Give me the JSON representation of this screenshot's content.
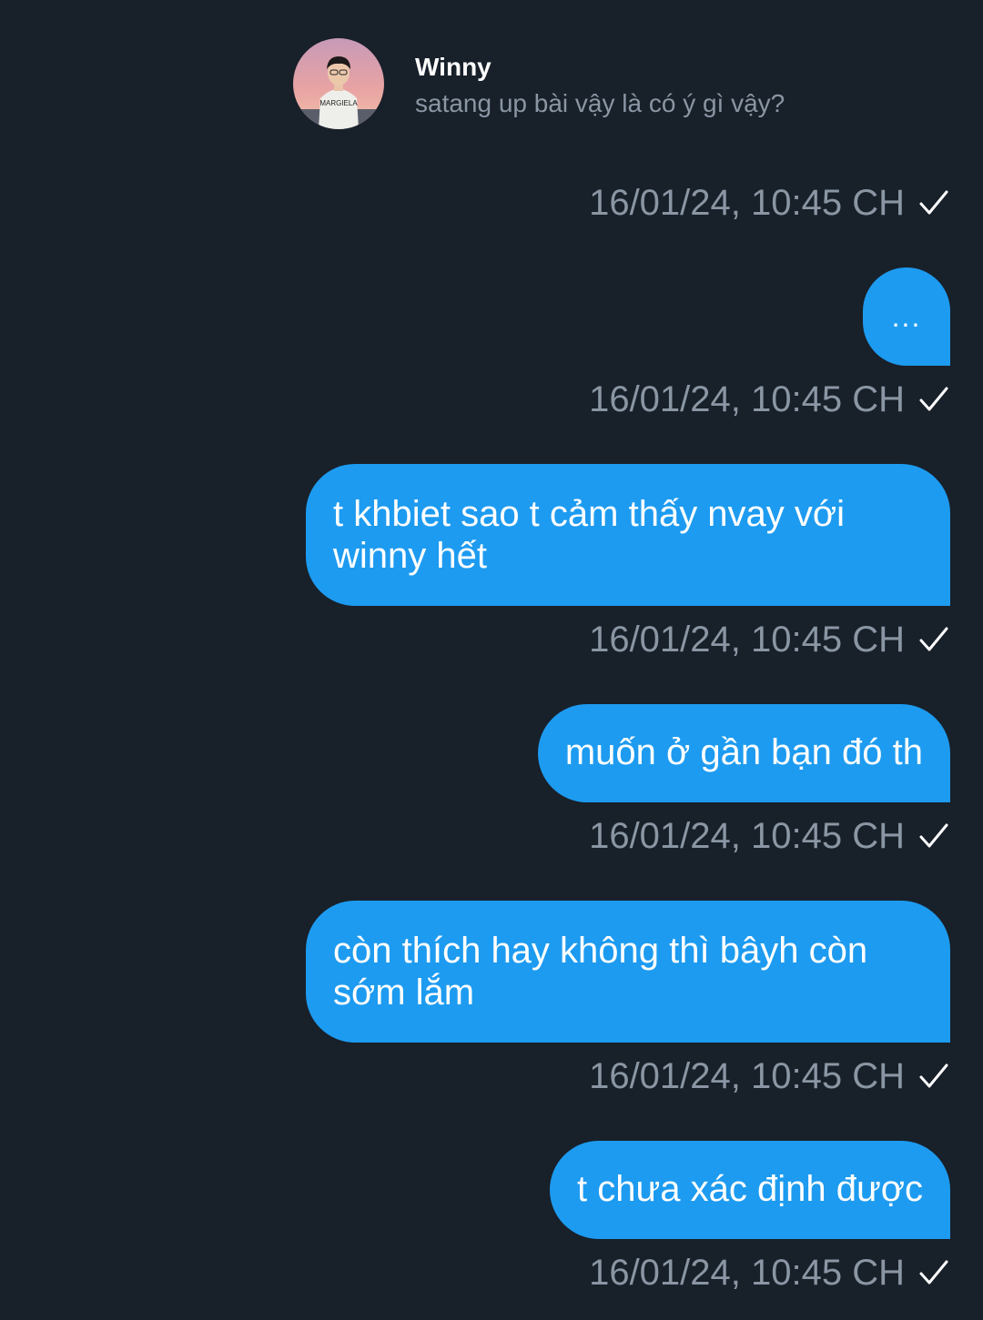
{
  "reply": {
    "name": "Winny",
    "text": "satang up bài vậy là có ý gì vậy?",
    "avatar_shirt_text": "MARGIELA"
  },
  "messages": [
    {
      "text": "...",
      "timestamp": "16/01/24, 10:45 CH"
    },
    {
      "text": "t khbiet sao t cảm thấy nvay với winny hết",
      "timestamp": "16/01/24, 10:45 CH"
    },
    {
      "text": "muốn ở gần bạn đó th",
      "timestamp": "16/01/24, 10:45 CH"
    },
    {
      "text": "còn thích hay không thì bâyh còn sớm lắm",
      "timestamp": "16/01/24, 10:45 CH"
    },
    {
      "text": "t chưa xác định được",
      "timestamp": "16/01/24, 10:45 CH"
    }
  ],
  "reply_timestamp": "16/01/24, 10:45 CH",
  "colors": {
    "background": "#18202a",
    "bubble": "#1d9bf0",
    "timestamp": "#8a96a3",
    "reply_text": "#8a96a3"
  },
  "icons": {
    "sent": "check-icon"
  }
}
